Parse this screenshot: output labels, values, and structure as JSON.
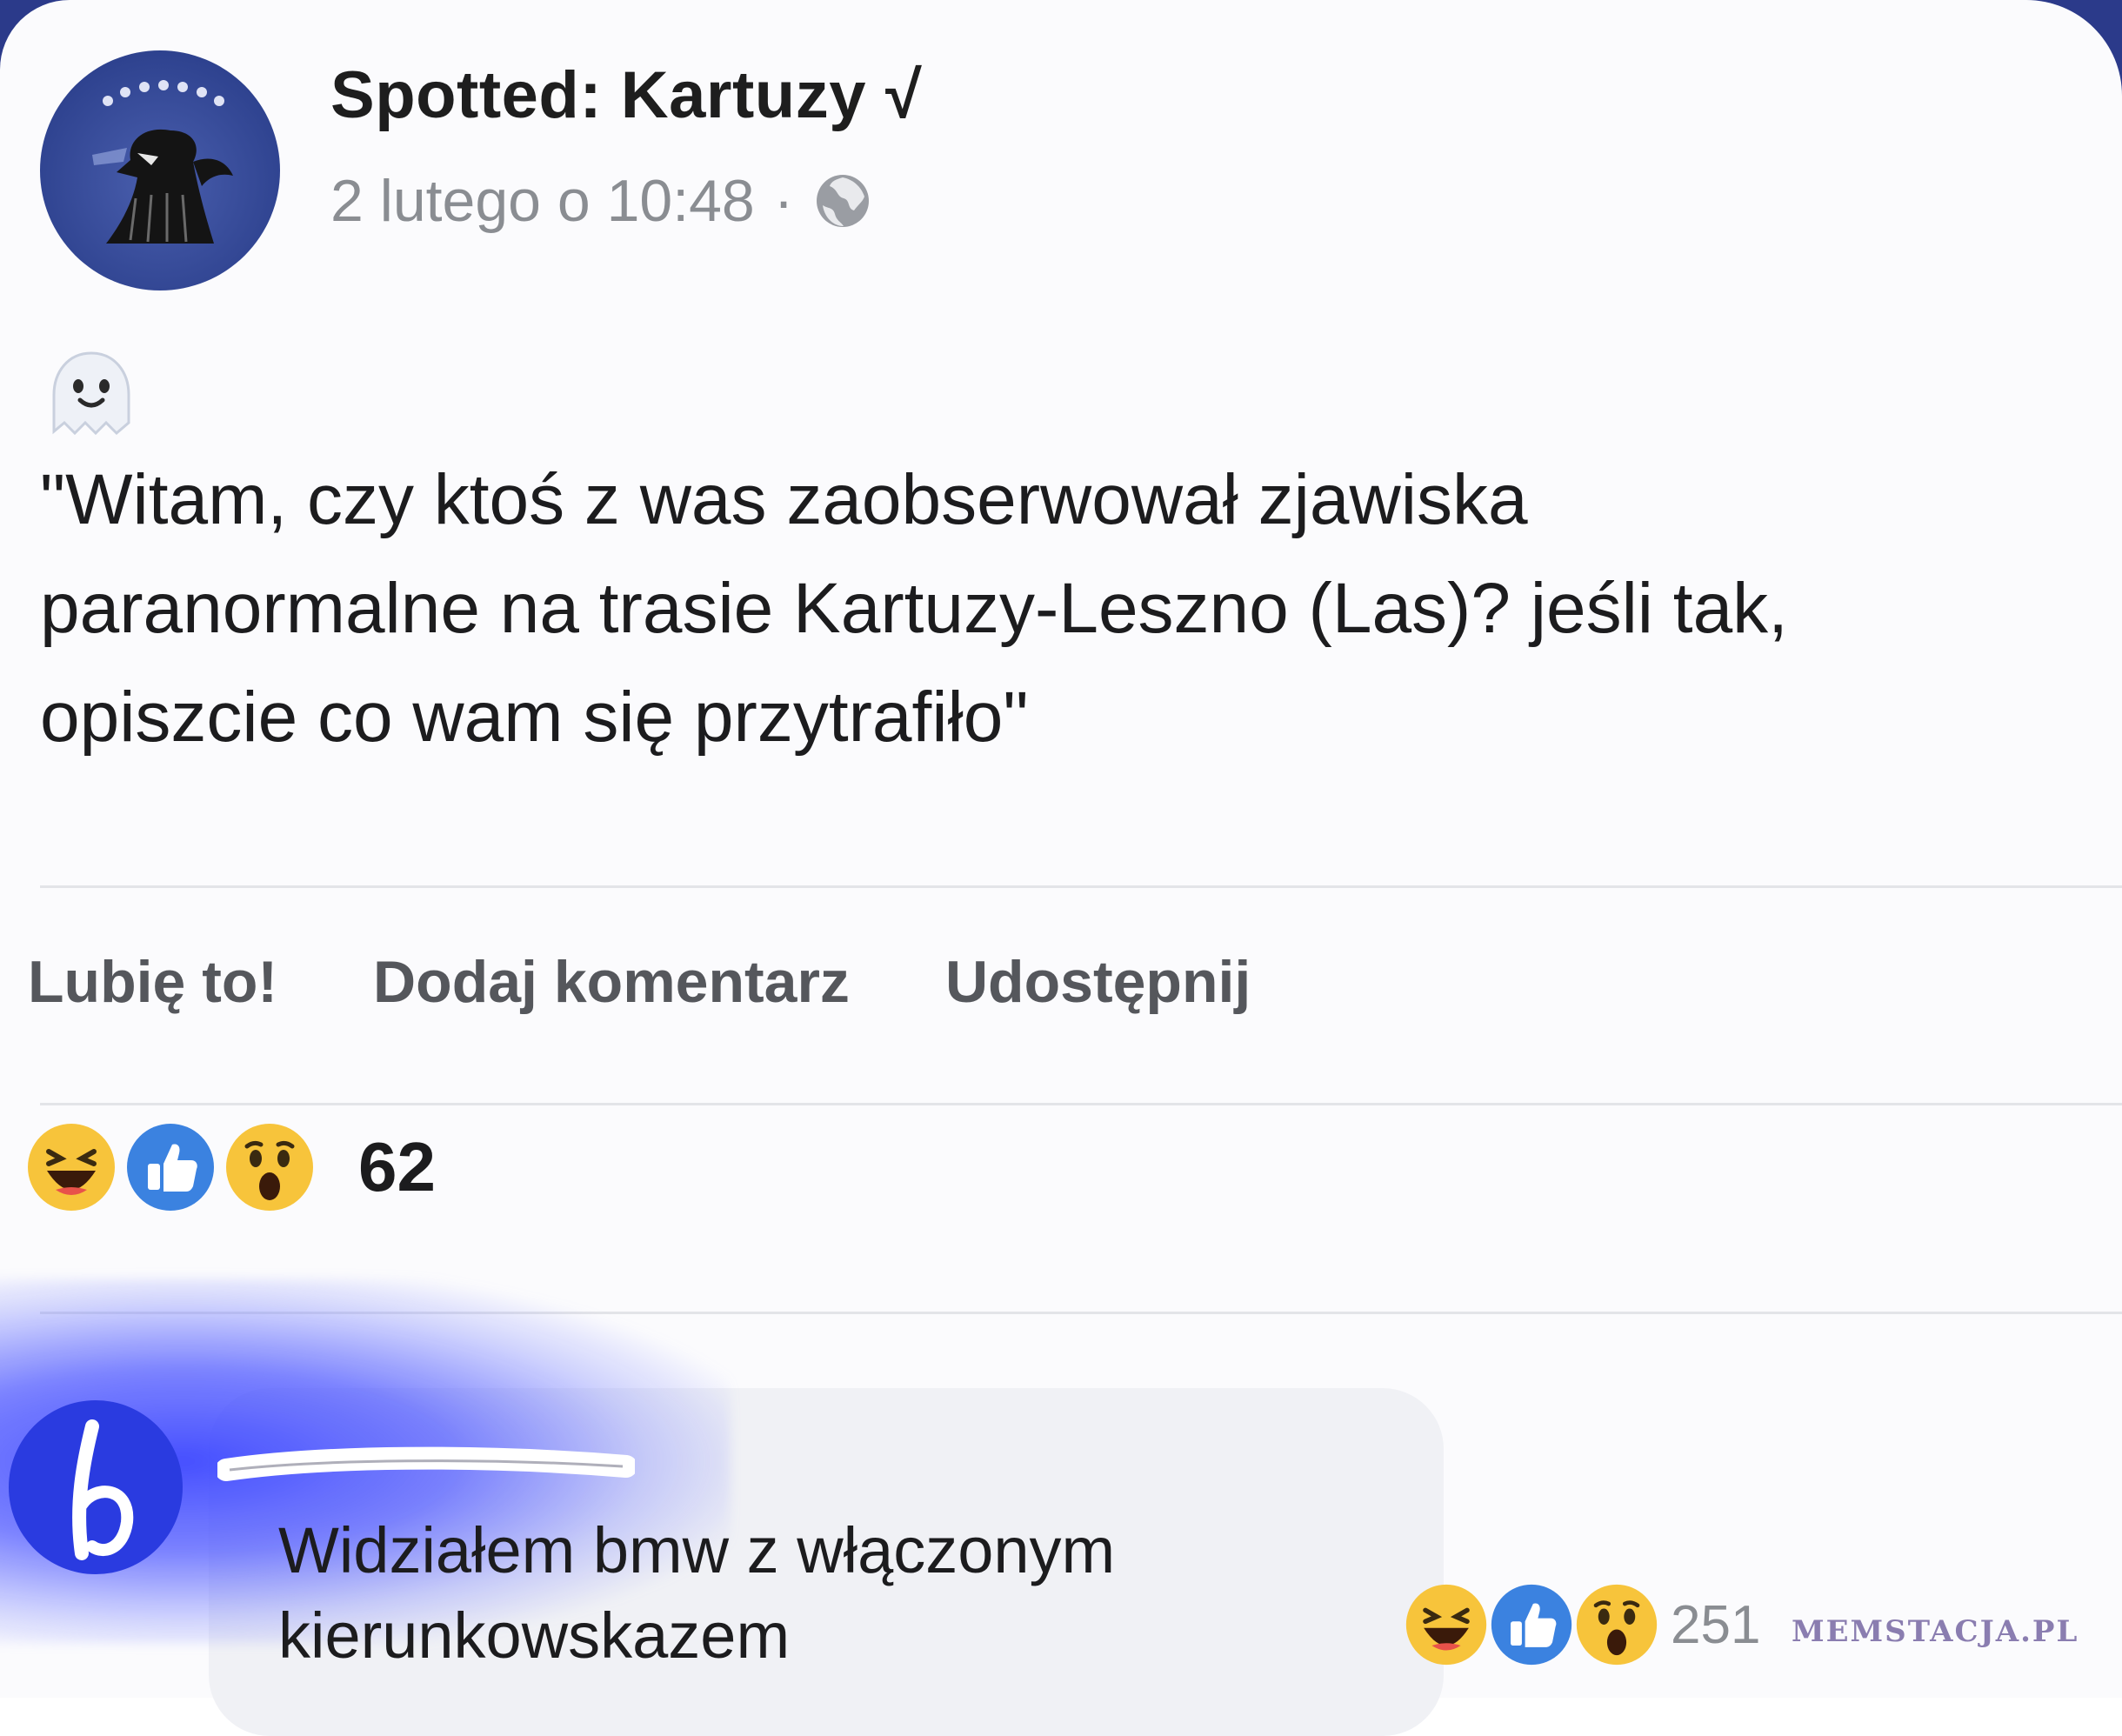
{
  "post": {
    "page_name": "Spotted: Kartuzy",
    "verified_mark": "√",
    "timestamp": "2 lutego o 10:48",
    "separator": "·",
    "privacy_icon": "globe-icon",
    "emoji": "ghost-emoji",
    "text": "\"Witam, czy ktoś z was zaobserwował zjawiska\nparanormalne na trasie Kartuzy-Leszno (Las)? jeśli tak,\nopiszcie co wam się przytrafiło\""
  },
  "actions": {
    "like_label": "Lubię to!",
    "comment_label": "Dodaj komentarz",
    "share_label": "Udostępnij"
  },
  "reactions": {
    "icons": [
      "haha-icon",
      "like-icon",
      "wow-icon"
    ],
    "count": "62"
  },
  "comment": {
    "text": "Widziałem bmw z włączonym\nkierunkowskazem",
    "reaction_icons": [
      "haha-icon",
      "like-icon",
      "wow-icon"
    ],
    "reaction_count": "251"
  },
  "watermark": "MEMSTACJA.PL",
  "colors": {
    "name_text": "#1e1e1e",
    "meta_text": "#8a8d92",
    "like_blue": "#3b82e0",
    "haha_yellow": "#f7c43b",
    "highlight_glow": "#3c46ff",
    "comment_bubble": "#f0f1f5"
  }
}
